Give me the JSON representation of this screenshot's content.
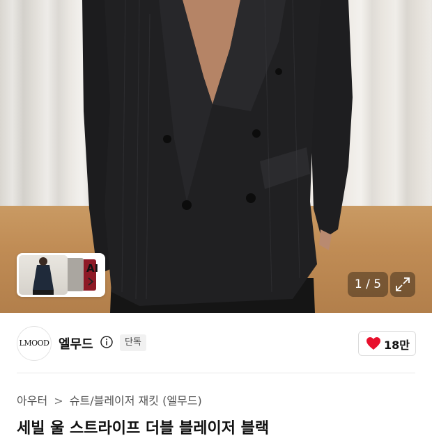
{
  "gallery": {
    "counter": "1 / 5",
    "ai_label": "AI"
  },
  "brand": {
    "logo_text": "LMOOD",
    "name": "엘무드",
    "exclusive_badge": "단독",
    "likes": "18만",
    "like_color": "#e8102c"
  },
  "breadcrumb": {
    "level1": "아우터",
    "level2": "슈트/블레이저 재킷 (엘무드)"
  },
  "product": {
    "title": "세빌 울 스트라이프 더블 블레이저 블랙"
  },
  "icons": [
    "info-icon",
    "heart-icon",
    "chevron-right-icon",
    "expand-icon"
  ]
}
